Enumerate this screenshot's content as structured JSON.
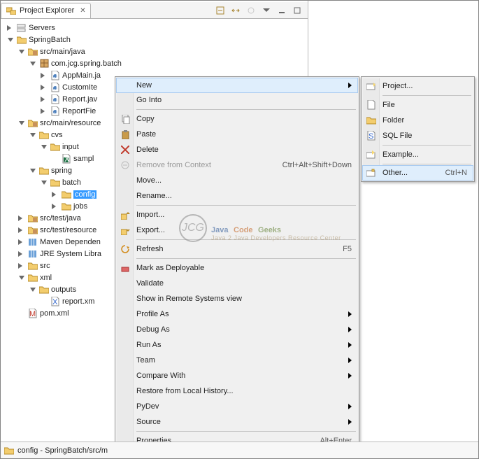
{
  "tab": {
    "title": "Project Explorer"
  },
  "tree": [
    {
      "depth": 0,
      "twist": "closed",
      "icon": "servers-icon",
      "label": "Servers"
    },
    {
      "depth": 0,
      "twist": "open",
      "icon": "project-folder-icon",
      "label": "SpringBatch"
    },
    {
      "depth": 1,
      "twist": "open",
      "icon": "package-folder-icon",
      "label": "src/main/java"
    },
    {
      "depth": 2,
      "twist": "open",
      "icon": "package-icon",
      "label": "com.jcg.spring.batch"
    },
    {
      "depth": 3,
      "twist": "closed",
      "icon": "java-file-icon",
      "label": "AppMain.ja"
    },
    {
      "depth": 3,
      "twist": "closed",
      "icon": "java-file-icon",
      "label": "CustomIte"
    },
    {
      "depth": 3,
      "twist": "closed",
      "icon": "java-file-icon",
      "label": "Report.jav"
    },
    {
      "depth": 3,
      "twist": "closed",
      "icon": "java-file-icon",
      "label": "ReportFie"
    },
    {
      "depth": 1,
      "twist": "open",
      "icon": "package-folder-icon",
      "label": "src/main/resource"
    },
    {
      "depth": 2,
      "twist": "open",
      "icon": "folder-icon",
      "label": "cvs"
    },
    {
      "depth": 3,
      "twist": "open",
      "icon": "folder-icon",
      "label": "input"
    },
    {
      "depth": 4,
      "twist": "none",
      "icon": "excel-file-icon",
      "label": "sampl"
    },
    {
      "depth": 2,
      "twist": "open",
      "icon": "folder-icon",
      "label": "spring"
    },
    {
      "depth": 3,
      "twist": "open",
      "icon": "folder-icon",
      "label": "batch"
    },
    {
      "depth": 4,
      "twist": "closed",
      "icon": "folder-icon",
      "label": "config",
      "selected": true
    },
    {
      "depth": 4,
      "twist": "closed",
      "icon": "folder-icon",
      "label": "jobs"
    },
    {
      "depth": 1,
      "twist": "closed",
      "icon": "package-folder-icon",
      "label": "src/test/java"
    },
    {
      "depth": 1,
      "twist": "closed",
      "icon": "package-folder-icon",
      "label": "src/test/resource"
    },
    {
      "depth": 1,
      "twist": "closed",
      "icon": "library-icon",
      "label": "Maven Dependen"
    },
    {
      "depth": 1,
      "twist": "closed",
      "icon": "library-icon",
      "label": "JRE System Libra"
    },
    {
      "depth": 1,
      "twist": "closed",
      "icon": "folder-icon",
      "label": "src"
    },
    {
      "depth": 1,
      "twist": "open",
      "icon": "folder-icon",
      "label": "xml"
    },
    {
      "depth": 2,
      "twist": "open",
      "icon": "folder-icon",
      "label": "outputs"
    },
    {
      "depth": 3,
      "twist": "none",
      "icon": "xml-file-icon",
      "label": "report.xm"
    },
    {
      "depth": 1,
      "twist": "none",
      "icon": "maven-file-icon",
      "label": "pom.xml"
    }
  ],
  "ctx": {
    "new": {
      "label": "New",
      "submenu": true
    },
    "go_into": {
      "label": "Go Into"
    },
    "copy": {
      "label": "Copy"
    },
    "paste": {
      "label": "Paste"
    },
    "delete": {
      "label": "Delete"
    },
    "remove_context": {
      "label": "Remove from Context",
      "shortcut": "Ctrl+Alt+Shift+Down",
      "disabled": true
    },
    "move": {
      "label": "Move..."
    },
    "rename": {
      "label": "Rename..."
    },
    "import": {
      "label": "Import..."
    },
    "export": {
      "label": "Export..."
    },
    "refresh": {
      "label": "Refresh",
      "shortcut": "F5"
    },
    "mark_deployable": {
      "label": "Mark as Deployable"
    },
    "validate": {
      "label": "Validate"
    },
    "show_remote": {
      "label": "Show in Remote Systems view"
    },
    "profile_as": {
      "label": "Profile As",
      "submenu": true
    },
    "debug_as": {
      "label": "Debug As",
      "submenu": true
    },
    "run_as": {
      "label": "Run As",
      "submenu": true
    },
    "team": {
      "label": "Team",
      "submenu": true
    },
    "compare_with": {
      "label": "Compare With",
      "submenu": true
    },
    "restore_history": {
      "label": "Restore from Local History..."
    },
    "pydev": {
      "label": "PyDev",
      "submenu": true
    },
    "source": {
      "label": "Source",
      "submenu": true
    },
    "properties": {
      "label": "Properties",
      "shortcut": "Alt+Enter"
    }
  },
  "submenu": {
    "project": {
      "label": "Project..."
    },
    "file": {
      "label": "File"
    },
    "folder": {
      "label": "Folder"
    },
    "sql_file": {
      "label": "SQL File"
    },
    "example": {
      "label": "Example..."
    },
    "other": {
      "label": "Other...",
      "shortcut": "Ctrl+N"
    }
  },
  "statusbar": {
    "text": "config - SpringBatch/src/m"
  },
  "watermark": {
    "l1": "Java",
    "l2": "Code",
    "l3": "Geeks",
    "tag": "Java 2 Java Developers Resource Center"
  }
}
